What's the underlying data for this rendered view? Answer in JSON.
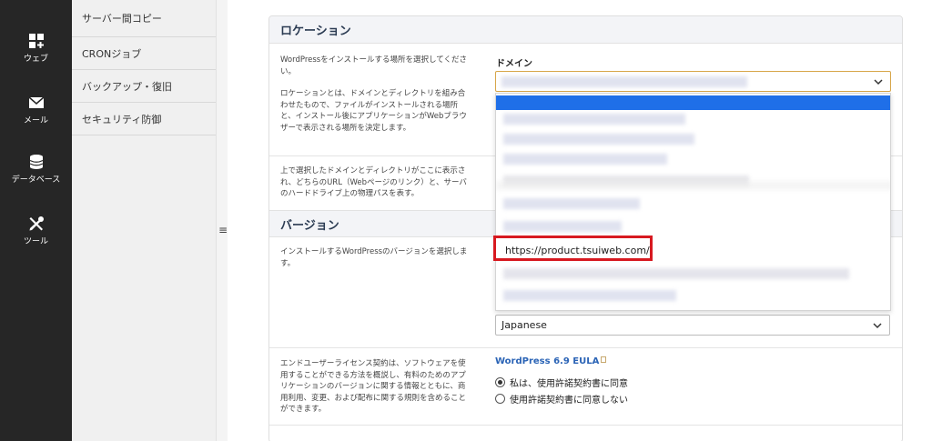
{
  "rail": {
    "items": [
      {
        "label": "ウェブ",
        "icon": "web-plus-icon"
      },
      {
        "label": "メール",
        "icon": "mail-icon"
      },
      {
        "label": "データベース",
        "icon": "database-icon"
      },
      {
        "label": "ツール",
        "icon": "tools-icon"
      }
    ]
  },
  "subnav": {
    "items": [
      {
        "label": "サーバー間コピー"
      },
      {
        "label": "CRONジョブ"
      },
      {
        "label": "バックアップ・復旧"
      },
      {
        "label": "セキュリティ防御"
      }
    ]
  },
  "collapse_icon": "≡",
  "location": {
    "title": "ロケーション",
    "desc1": "WordPressをインストールする場所を選択してください。",
    "desc2": "ロケーションとは、ドメインとディレクトリを組み合わせたもので、ファイルがインストールされる場所と、インストール後にアプリケーションがWebブラウザーで表示される場所を決定します。",
    "desc3": "上で選択したドメインとディレクトリがここに表示され、どちらのURL（Webページのリンク）と、サーバのハードドライブ上の物理パスを表す。",
    "domain_label": "ドメイン",
    "highlighted_option": "https://product.tsuiweb.com/"
  },
  "version": {
    "title": "バージョン",
    "desc": "インストールするWordPressのバージョンを選択します。",
    "language_value": "Japanese"
  },
  "eula": {
    "desc": "エンドユーザーライセンス契約は、ソフトウェアを使用することができる方法を概説し、有料のためのアプリケーションのバージョンに関する情報とともに、商用利用、変更、および配布に関する規則を含めることができます。",
    "link": "WordPress 6.9 EULA",
    "agree": "私は、使用許諾契約書に同意",
    "disagree": "使用許諾契約書に同意しない"
  },
  "colors": {
    "rail": "#262626",
    "accent_blue": "#1f6fe8",
    "highlight_red": "#d71920",
    "link_blue": "#2b64b6"
  }
}
